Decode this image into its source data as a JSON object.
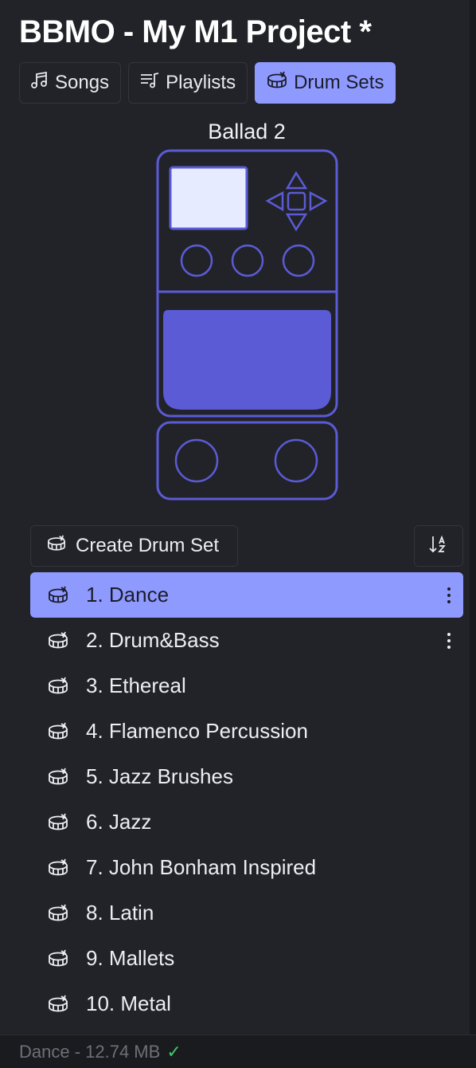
{
  "app": {
    "title": "BBMO - My M1 Project *"
  },
  "tabs": [
    {
      "label": "Songs",
      "icon": "music-note-icon",
      "active": false
    },
    {
      "label": "Playlists",
      "icon": "playlist-icon",
      "active": false
    },
    {
      "label": "Drum Sets",
      "icon": "drum-icon",
      "active": true
    }
  ],
  "preview": {
    "name": "Ballad 2"
  },
  "toolbar": {
    "create_label": "Create Drum Set",
    "sort_icon": "sort-alpha-icon"
  },
  "drum_sets": [
    {
      "label": "1. Dance",
      "selected": true,
      "menu": true
    },
    {
      "label": "2. Drum&Bass",
      "selected": false,
      "menu": true
    },
    {
      "label": "3. Ethereal",
      "selected": false,
      "menu": false
    },
    {
      "label": "4. Flamenco Percussion",
      "selected": false,
      "menu": false
    },
    {
      "label": "5. Jazz Brushes",
      "selected": false,
      "menu": false
    },
    {
      "label": "6. Jazz",
      "selected": false,
      "menu": false
    },
    {
      "label": "7. John Bonham Inspired",
      "selected": false,
      "menu": false
    },
    {
      "label": "8. Latin",
      "selected": false,
      "menu": false
    },
    {
      "label": "9. Mallets",
      "selected": false,
      "menu": false
    },
    {
      "label": "10. Metal",
      "selected": false,
      "menu": false
    }
  ],
  "status": {
    "text": "Dance - 12.74 MB",
    "check": "✓"
  },
  "colors": {
    "accent": "#8f9aff",
    "pedal": "#5b5bd6",
    "screen": "#e6ebff",
    "success": "#3fc768"
  }
}
